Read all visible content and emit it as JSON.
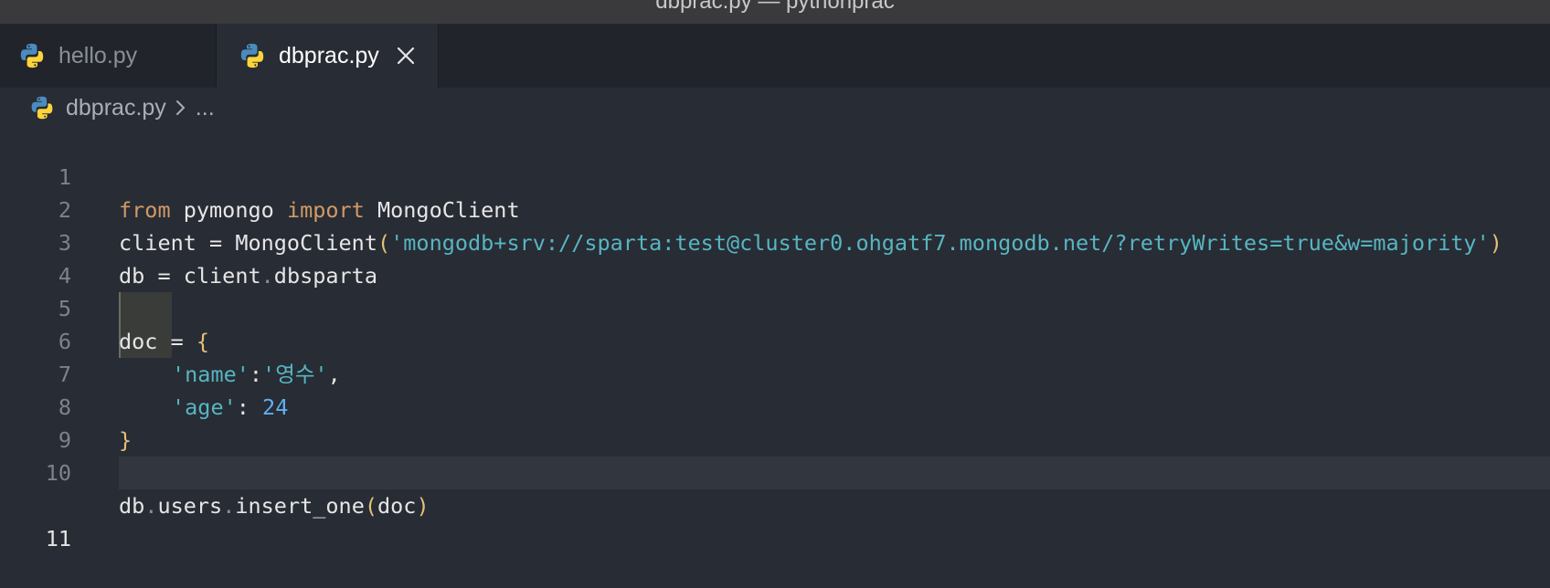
{
  "window": {
    "title": "dbprac.py — pythonprac"
  },
  "tabs": [
    {
      "label": "hello.py",
      "icon": "python-file-icon",
      "active": false
    },
    {
      "label": "dbprac.py",
      "icon": "python-file-icon",
      "active": true,
      "close_icon": "close-icon"
    }
  ],
  "breadcrumb": {
    "file": "dbprac.py",
    "more": "..."
  },
  "editor": {
    "current_line": 11,
    "line_numbers": [
      "1",
      "2",
      "3",
      "4",
      "5",
      "6",
      "7",
      "8",
      "9",
      "10",
      "11"
    ],
    "lines": {
      "l1": {
        "from": "from",
        "module": " pymongo ",
        "import": "import",
        "name": " MongoClient"
      },
      "l2": {
        "lhs": "client = MongoClient",
        "open": "(",
        "str": "'mongodb+srv://sparta:test@cluster0.ohgatf7.mongodb.net/?retryWrites=true&w=majority'",
        "close": ")"
      },
      "l3": {
        "a": "db = client",
        "dot": ".",
        "b": "dbsparta"
      },
      "l5": {
        "lhs": "doc = ",
        "brace": "{"
      },
      "l6": {
        "key": "'name'",
        "colon": ":",
        "val": "'영수'",
        "comma": ","
      },
      "l7": {
        "key": "'age'",
        "colon": ": ",
        "val": "24"
      },
      "l8": {
        "brace": "}"
      },
      "l10": {
        "a": "db",
        "dot1": ".",
        "b": "users",
        "dot2": ".",
        "c": "insert_one",
        "open": "(",
        "arg": "doc",
        "close": ")"
      }
    }
  },
  "colors": {
    "background": "#282c34",
    "keyword": "#d19a66",
    "string": "#56b6c2",
    "number": "#61afef",
    "bracket": "#e5c07b"
  }
}
